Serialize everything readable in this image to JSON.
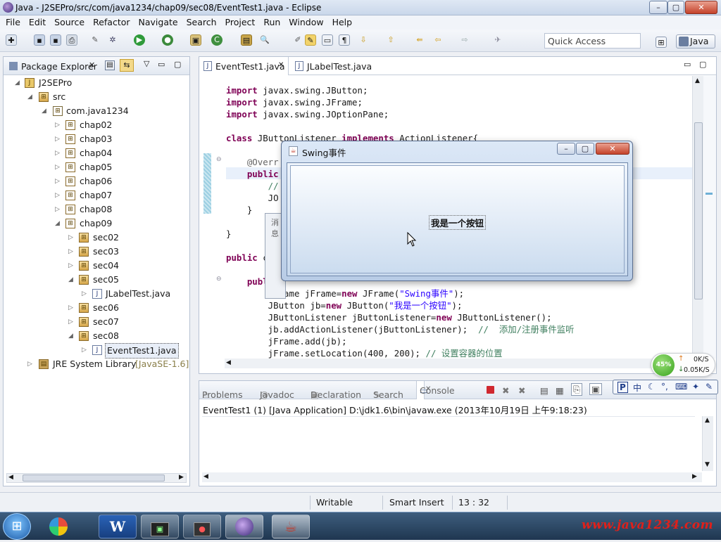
{
  "window": {
    "title": "Java - J2SEPro/src/com/java1234/chap09/sec08/EventTest1.java - Eclipse"
  },
  "menu": [
    "File",
    "Edit",
    "Source",
    "Refactor",
    "Navigate",
    "Search",
    "Project",
    "Run",
    "Window",
    "Help"
  ],
  "toolbar": {
    "quick_access": "Quick Access",
    "perspective": "Java"
  },
  "package_explorer": {
    "title": "Package Explorer",
    "project": "J2SEPro",
    "src": "src",
    "package": "com.java1234",
    "chapters": [
      "chap02",
      "chap03",
      "chap04",
      "chap05",
      "chap06",
      "chap07",
      "chap08",
      "chap09"
    ],
    "sections": [
      "sec02",
      "sec03",
      "sec04",
      "sec05",
      "sec06",
      "sec07",
      "sec08"
    ],
    "file_sec05": "JLabelTest.java",
    "file_sec08": "EventTest1.java",
    "jre_label": "JRE System Library",
    "jre_version": "[JavaSE-1.6]"
  },
  "editor": {
    "tabs": [
      "EventTest1.java",
      "JLabelTest.java"
    ],
    "lines": [
      "import javax.swing.JButton;",
      "import javax.swing.JFrame;",
      "import javax.swing.JOptionPane;",
      "",
      "class JButtonListener implements ActionListener{",
      "",
      "    @Overr",
      "    public",
      "        //",
      "        JO",
      "    }",
      "",
      "}",
      "",
      "public cla",
      "",
      "    publ",
      "        JFrame jFrame=new JFrame(\"Swing事件\");",
      "        JButton jb=new JButton(\"我是一个按钮\");",
      "        JButtonListener jButtonListener=new JButtonListener();",
      "        jb.addActionListener(jButtonListener);  //  添加/注册事件监听",
      "        jFrame.add(jb);",
      "        jFrame.setLocation(400, 200); // 设置容器的位置"
    ]
  },
  "dialog": {
    "title": "Swing事件",
    "button": "我是一个按钮",
    "hidden_title": "消息"
  },
  "network": {
    "percent": "45%",
    "up": "0K/S",
    "down": "0.05K/S"
  },
  "console": {
    "tabs": [
      "Problems",
      "Javadoc",
      "Declaration",
      "Search",
      "Console"
    ],
    "launch": "EventTest1 (1) [Java Application] D:\\jdk1.6\\bin\\javaw.exe (2013年10月19日 上午9:18:23)"
  },
  "status": {
    "writable": "Writable",
    "insert": "Smart Insert",
    "position": "13 : 32"
  },
  "watermark": "www.java1234.com",
  "colors": {
    "keyword": "#7f0055",
    "string": "#2a00ff",
    "comment": "#3f7f5f"
  }
}
